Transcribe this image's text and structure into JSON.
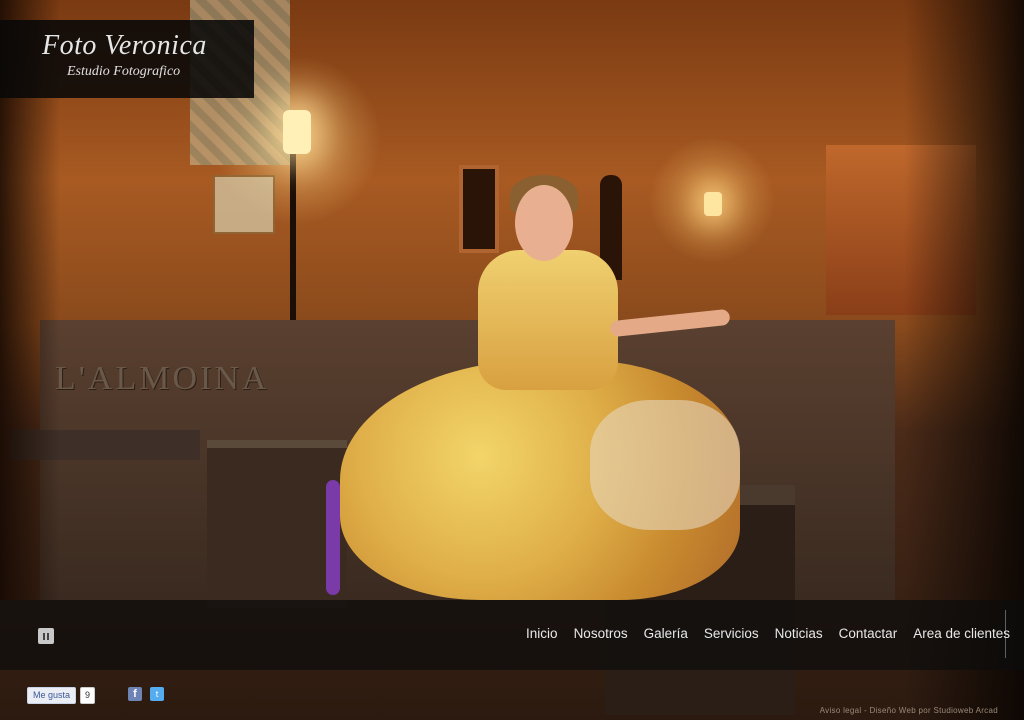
{
  "logo": {
    "title": "Foto Veronica",
    "subtitle": "Estudio Fotografico"
  },
  "slideshow": {
    "pause_icon": "pause-icon"
  },
  "nav": {
    "items": [
      {
        "label": "Inicio"
      },
      {
        "label": "Nosotros"
      },
      {
        "label": "Galería"
      },
      {
        "label": "Servicios"
      },
      {
        "label": "Noticias"
      },
      {
        "label": "Contactar"
      },
      {
        "label": "Area de clientes"
      }
    ]
  },
  "footer": {
    "like_label": "Me gusta",
    "like_count": "9",
    "facebook_icon": "facebook-icon",
    "twitter_icon": "twitter-icon",
    "facebook_glyph": "f",
    "twitter_glyph": "t",
    "credits": "Aviso legal - Diseño Web por Studioweb Arcad"
  },
  "colors": {
    "nav_background": "#0c0c0c",
    "logo_background": "#080808",
    "nav_text": "#e8e8e8"
  }
}
